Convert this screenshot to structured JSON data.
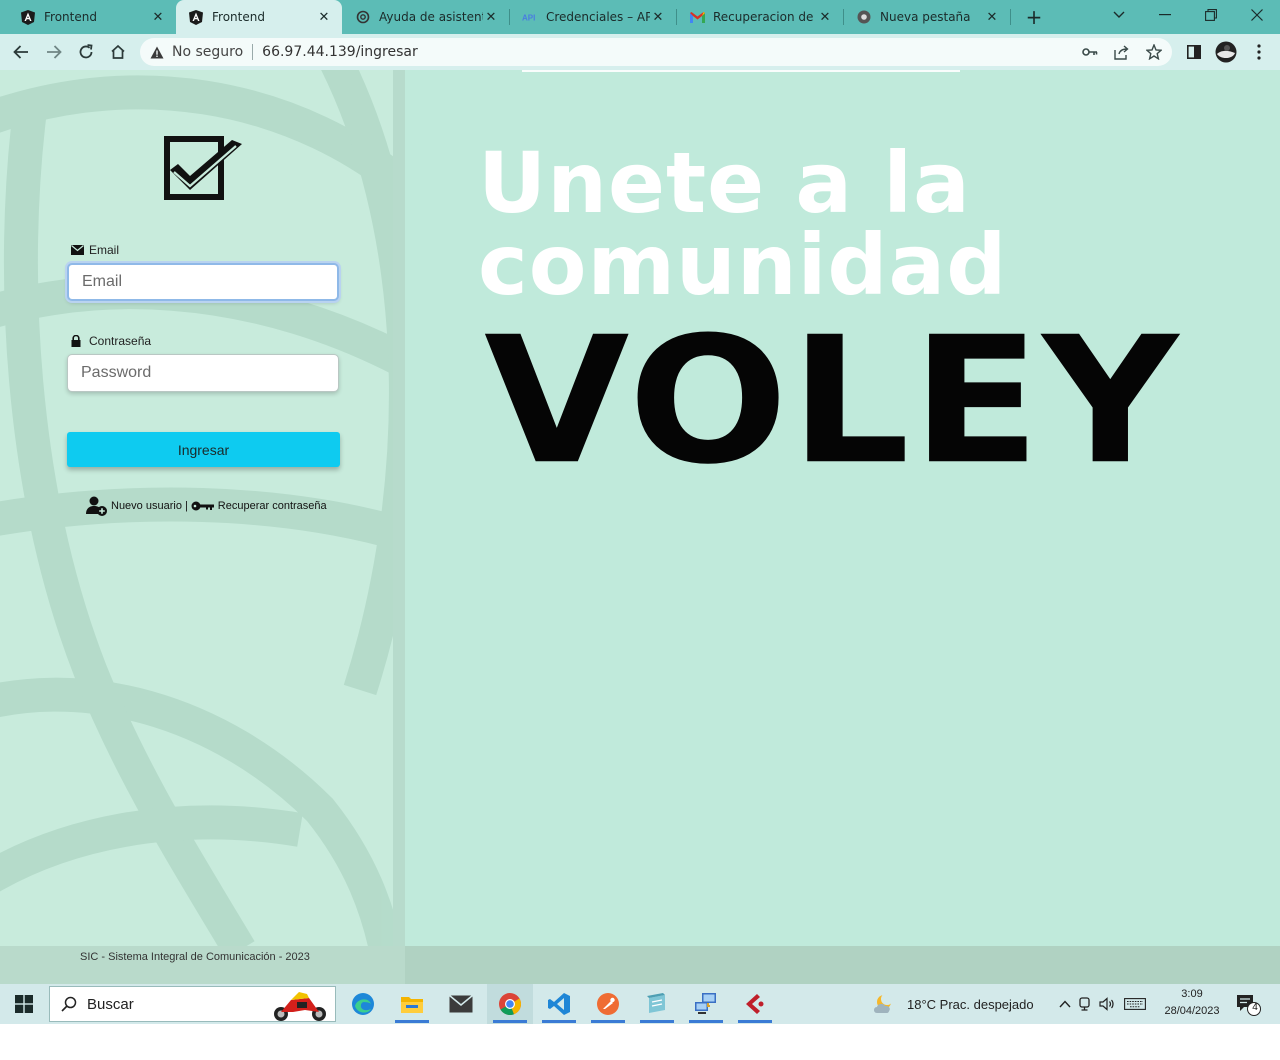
{
  "browser": {
    "tabs": [
      {
        "title": "Frontend",
        "icon": "angular-icon",
        "active": false
      },
      {
        "title": "Frontend",
        "icon": "angular-icon",
        "active": true
      },
      {
        "title": "Ayuda de asistente.",
        "icon": "openai-icon",
        "active": false
      },
      {
        "title": "Credenciales – APIs",
        "icon": "api-icon",
        "active": false
      },
      {
        "title": "Recuperacion de tu",
        "icon": "gmail-icon",
        "active": false
      },
      {
        "title": "Nueva pestaña",
        "icon": "chrome-icon",
        "active": false
      }
    ],
    "omnibox": {
      "security": "No seguro",
      "url": "66.97.44.139/ingresar"
    }
  },
  "login": {
    "email_label": "Email",
    "email_placeholder": "Email",
    "password_label": "Contraseña",
    "password_placeholder": "Password",
    "submit_label": "Ingresar",
    "new_user_link": "Nuevo usuario",
    "link_separator": "|",
    "recover_link": "Recuperar contraseña"
  },
  "hero": {
    "line1": "Unete a la",
    "line2": "comunidad",
    "line3": "VOLEY"
  },
  "footer": {
    "text": "SIC - Sistema Integral de Comunicación - 2023"
  },
  "taskbar": {
    "search_label": "Buscar",
    "weather": "18°C  Prac. despejado",
    "time": "3:09",
    "date": "28/04/2023",
    "notifications": "4"
  },
  "colors": {
    "page_bg": "#c0eadb",
    "button": "#0ecbf0",
    "tabstrip": "#5cbcb6",
    "toolbar": "#d6efed"
  }
}
